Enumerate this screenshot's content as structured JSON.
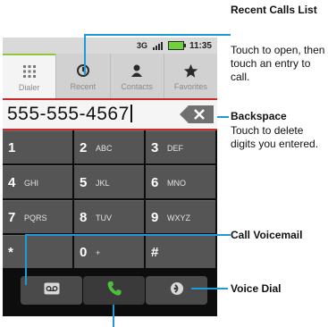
{
  "status": {
    "network": "3G",
    "time": "11:35",
    "battery_color": "#6fd23a"
  },
  "tabs": [
    {
      "label": "Dialer",
      "icon": "dialpad-icon"
    },
    {
      "label": "Recent",
      "icon": "recent-calls-icon"
    },
    {
      "label": "Contacts",
      "icon": "contacts-icon"
    },
    {
      "label": "Favorites",
      "icon": "star-icon"
    }
  ],
  "number_field": {
    "value": "555-555-4567"
  },
  "keys": [
    {
      "digit": "1",
      "letters": ""
    },
    {
      "digit": "2",
      "letters": "ABC"
    },
    {
      "digit": "3",
      "letters": "DEF"
    },
    {
      "digit": "4",
      "letters": "GHI"
    },
    {
      "digit": "5",
      "letters": "JKL"
    },
    {
      "digit": "6",
      "letters": "MNO"
    },
    {
      "digit": "7",
      "letters": "PQRS"
    },
    {
      "digit": "8",
      "letters": "TUV"
    },
    {
      "digit": "9",
      "letters": "WXYZ"
    },
    {
      "digit": "*",
      "letters": ""
    },
    {
      "digit": "0",
      "letters": "+"
    },
    {
      "digit": "#",
      "letters": ""
    }
  ],
  "bottom_buttons": [
    {
      "icon": "voicemail-icon"
    },
    {
      "icon": "phone-icon"
    },
    {
      "icon": "voice-dial-icon"
    }
  ],
  "callouts": {
    "recent": {
      "title": "Recent Calls List",
      "body": "Touch to open, then touch an entry to call."
    },
    "backspace": {
      "title": "Backspace",
      "body": "Touch to delete digits you entered."
    },
    "voicemail": {
      "title": "Call Voicemail"
    },
    "voice_dial": {
      "title": "Voice Dial"
    }
  },
  "colors": {
    "accent_leader": "#1e9bd7",
    "focus_border": "#cc2a2a",
    "active_tab": "#8ec73d",
    "call_icon": "#4cc03a"
  }
}
